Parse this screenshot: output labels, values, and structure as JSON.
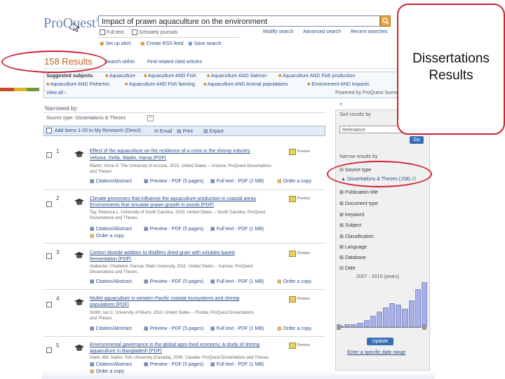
{
  "callout": {
    "line1": "Dissertations",
    "line2": "Results"
  },
  "header": {
    "logo": "ProQuest",
    "search_value": "Impact of prawn aquaculture on the environment",
    "full_text_label": "Full text",
    "scholarly_label": "Scholarly journals",
    "links": [
      "Modify search",
      "Advanced search",
      "Recent searches"
    ],
    "alerts": [
      "Set up alert",
      "Create RSS feed",
      "Save search"
    ]
  },
  "results": {
    "count_label": "158 Results",
    "search_within": "Search within",
    "find_citing": "Find related cited articles"
  },
  "suggested": {
    "label": "Suggested subjects",
    "row1": [
      "Aquaculture",
      "Aquaculture AND Fish",
      "Aquaculture AND Salmon",
      "Aquaculture AND Fish production"
    ],
    "row2": [
      "Aquaculture AND Fisheries",
      "Aquaculture AND Fish farming",
      "Aquaculture AND Animal populations",
      "Environment AND Impacts"
    ],
    "view_all": "View all",
    "powered": "Powered by ProQuest Summon"
  },
  "narrowed": {
    "label": "Narrowed by:",
    "filter": "Source type: Dissertations & Theses"
  },
  "toolbar": {
    "add_items": "Add items 1-20 to My Research (Direct)",
    "email": "Email",
    "print": "Print",
    "export": "Export"
  },
  "items": [
    {
      "num": "1",
      "title": "Effect of the aquaculture on the resilience of a crisis in the shrimp industry",
      "title2": "Velyour, Della, Wadie, Hamp [PDF]",
      "meta": "Martin, Vince S. The University of Arizona, 2010. United States -- Arizona: ProQuest Dissertations",
      "meta2": "and Theses",
      "links": [
        "Citation/Abstract",
        "Preview - PDF (5 pages)",
        "Full text - PDF (2 MB)",
        "Order a copy"
      ]
    },
    {
      "num": "2",
      "title": "Climate processes that influence the aquaculture production in coastal areas",
      "title2": "Environments that simulate prawn growth in ponds [PDF]",
      "meta": "Tay, Rebecca L. University of South Carolina, 2010. United States -- South Carolina: ProQuest",
      "meta2": "Dissertations and Theses.",
      "links": [
        "Citation/Abstract",
        "Preview - PDF (5 pages)",
        "Full text - PDF (1 MB)",
        "Order a copy"
      ]
    },
    {
      "num": "3",
      "title": "Carbon dioxide addition to distillers dried grain with solubles based",
      "title2": "fermentation [PDF]",
      "meta": "Alabaster, Chadwick. Kansas State University, 2011. United States -- Kansas: ProQuest",
      "meta2": "Dissertations and Theses.",
      "links": [
        "Citation/Abstract",
        "Preview - PDF (5 pages)",
        "Full text - PDF (1 MB)",
        "Order a copy"
      ]
    },
    {
      "num": "4",
      "title": "Mullet aquaculture in western Pacific coastal ecosystems and shrimp",
      "title2": "populations [PDF]",
      "meta": "Smith, Ian C. University of Miami, 2010. United States -- Florida: ProQuest Dissertations",
      "meta2": "and Theses.",
      "links": [
        "Citation/Abstract",
        "Preview - PDF (5 pages)",
        "Full text - PDF (1 MB)",
        "Order a copy"
      ]
    },
    {
      "num": "5",
      "title": "Environmental governance in the global agro-food economy: A study of shrimp",
      "title2": "aquaculture in Bangladesh [PDF]",
      "meta": "Islam, Md. Saidul. York University (Canada), 2008. Canada: ProQuest Dissertations and Theses.",
      "meta2": "",
      "links": [
        "Citation/Abstract",
        "Preview - PDF (5 pages)",
        "Full text - PDF (1 MB)",
        "Order a copy"
      ]
    }
  ],
  "sidebar": {
    "sort_label": "Sort results by",
    "sort_value": "Relevance",
    "go": "Go",
    "narrow_label": "Narrow results by",
    "facets": [
      "Source type",
      "Dissertations & Theses (158)",
      "Publication title",
      "Document type",
      "Keyword",
      "Subject",
      "Classification",
      "Language",
      "Database",
      "Date"
    ],
    "date_range": "2007 - 2010 (years)",
    "update": "Update",
    "enter_range": "Enter a specific date range"
  },
  "histogram": {
    "values": [
      1,
      2,
      2,
      3,
      5,
      8,
      11,
      14,
      17,
      16,
      13,
      19,
      27,
      32
    ]
  }
}
